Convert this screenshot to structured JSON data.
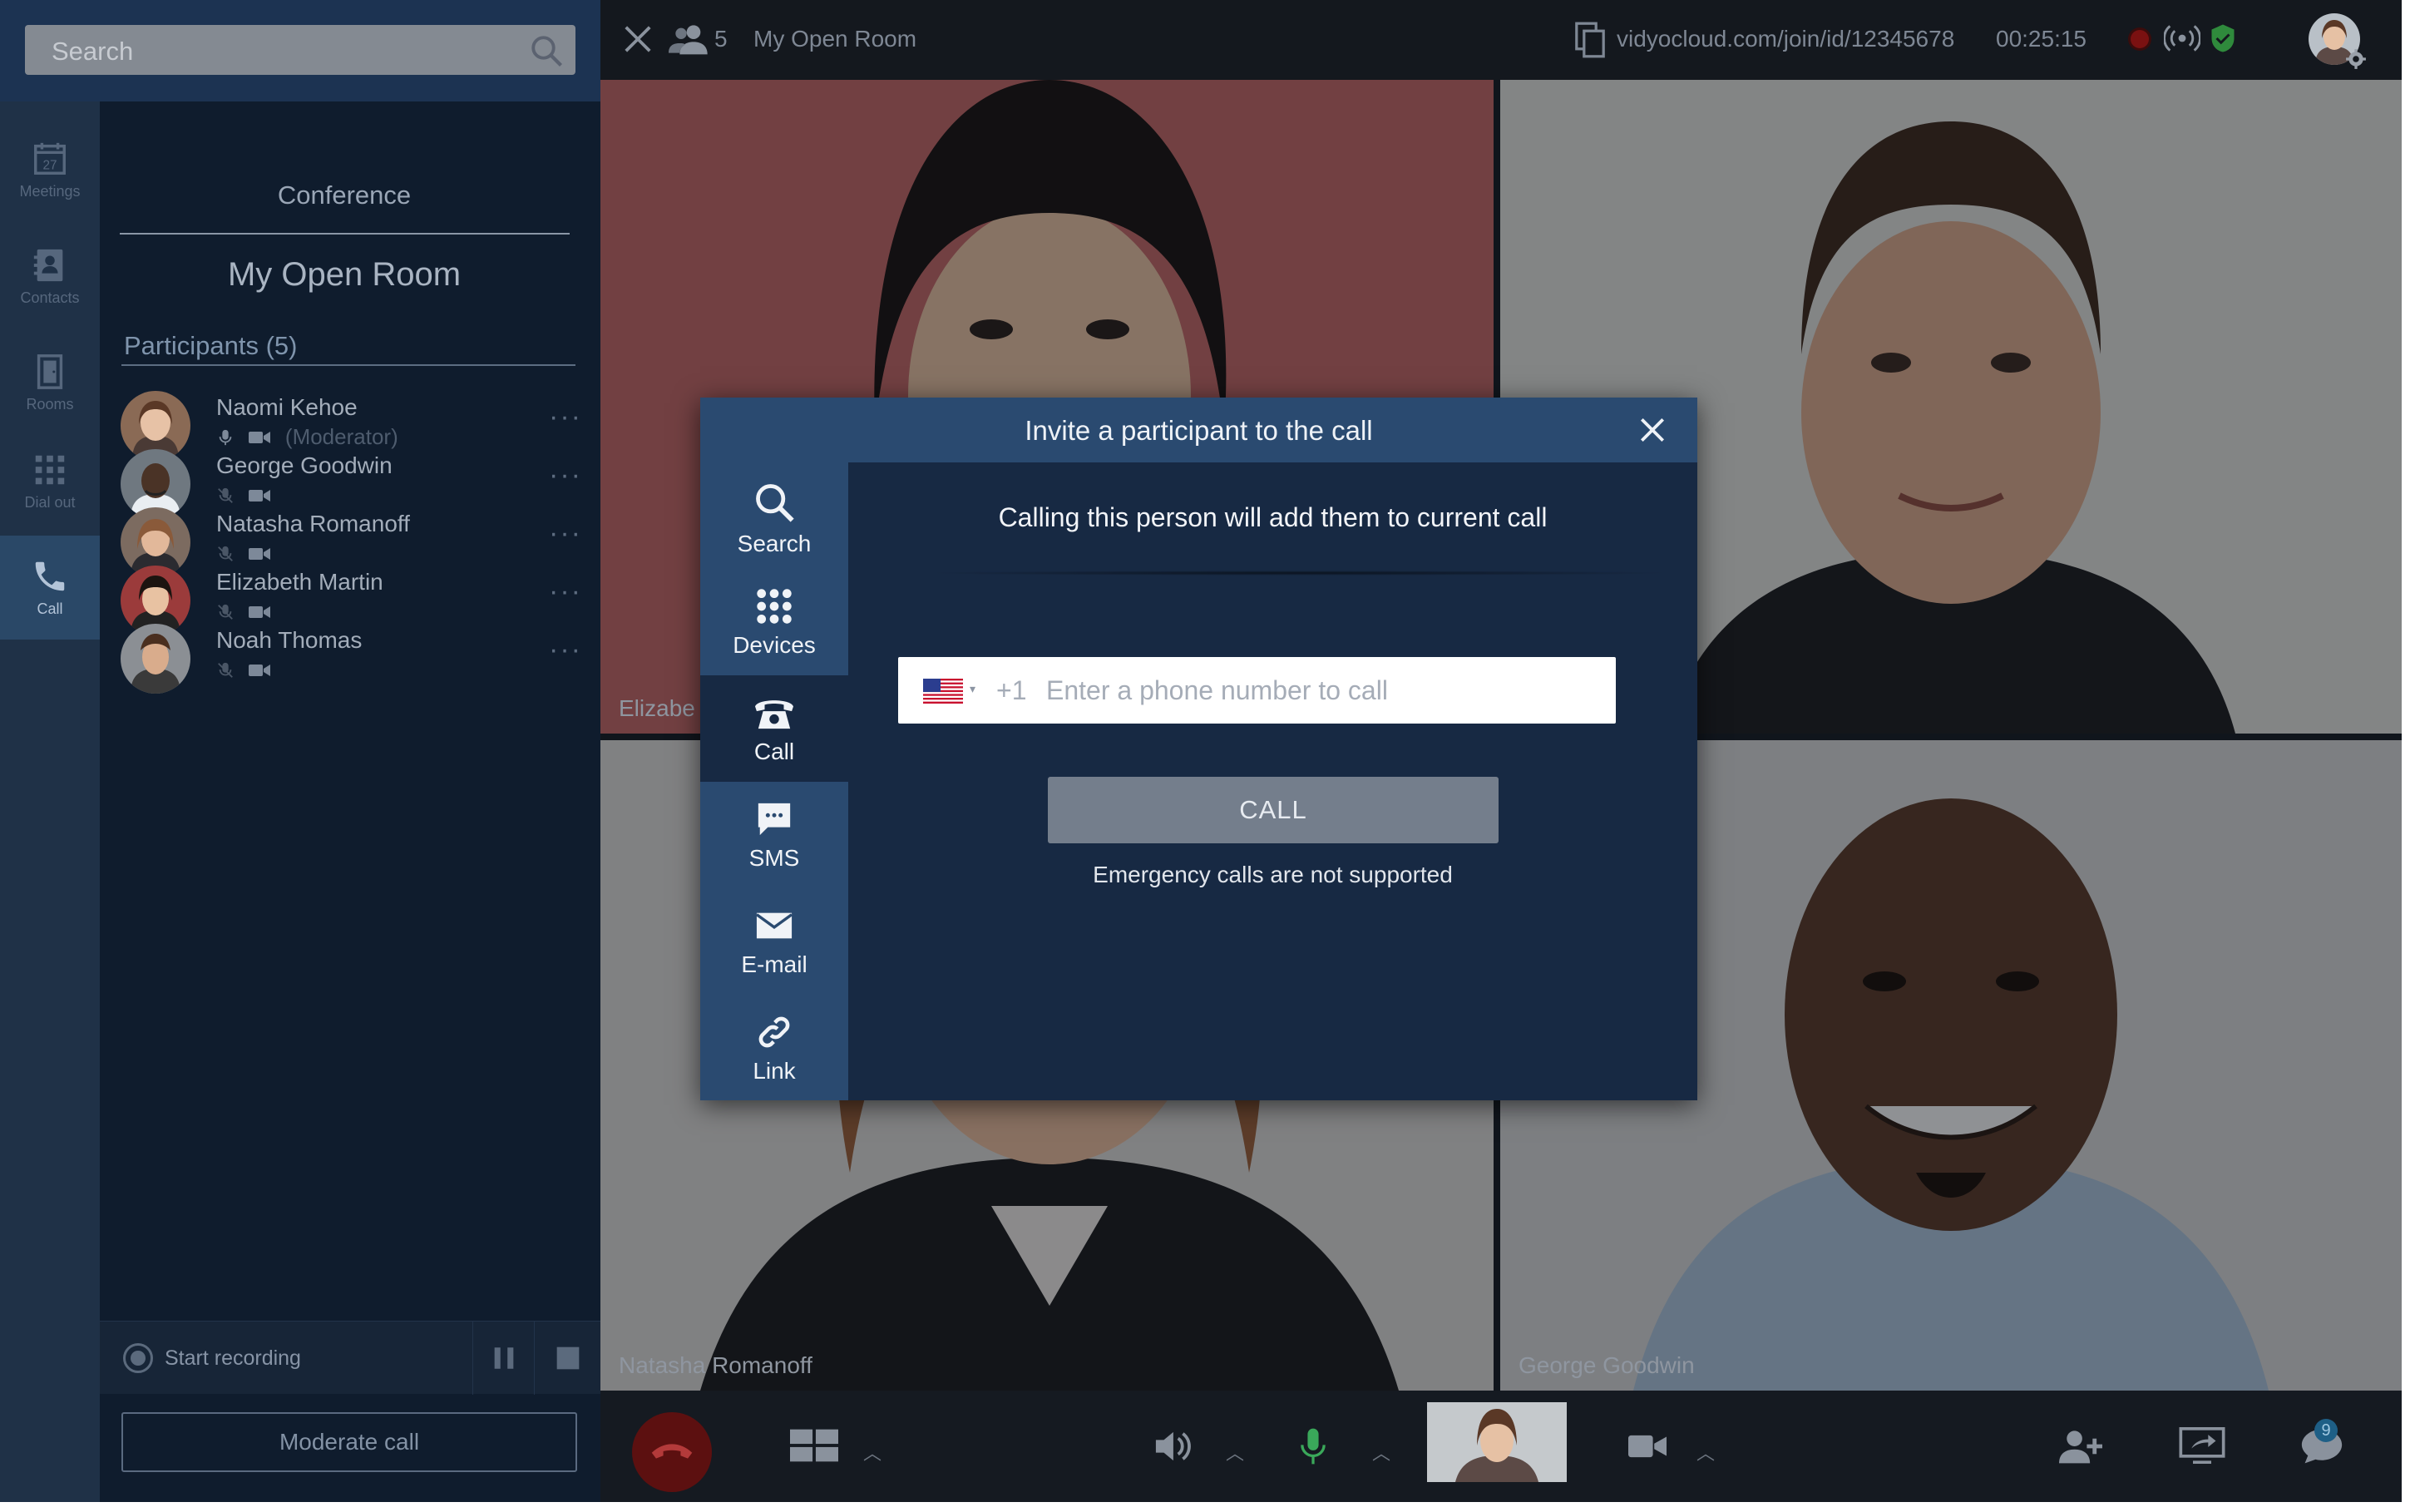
{
  "search": {
    "placeholder": "Search"
  },
  "nav": {
    "items": [
      {
        "label": "Meetings",
        "day": "27"
      },
      {
        "label": "Contacts"
      },
      {
        "label": "Rooms"
      },
      {
        "label": "Dial out"
      },
      {
        "label": "Call"
      }
    ]
  },
  "panel": {
    "section": "Conference",
    "room": "My Open Room",
    "participants_header": "Participants (5)",
    "participants": [
      {
        "name": "Naomi Kehoe",
        "role": "(Moderator)"
      },
      {
        "name": "George Goodwin",
        "role": ""
      },
      {
        "name": "Natasha Romanoff",
        "role": ""
      },
      {
        "name": "Elizabeth Martin",
        "role": ""
      },
      {
        "name": "Noah Thomas",
        "role": ""
      }
    ],
    "recording_label": "Start recording",
    "moderate_label": "Moderate call"
  },
  "topbar": {
    "participant_count": "5",
    "room": "My Open Room",
    "url": "vidyocloud.com/join/id/12345678",
    "timer": "00:25:15"
  },
  "video": {
    "tiles": [
      {
        "label": ""
      },
      {
        "label": ""
      },
      {
        "label": "Natasha Romanoff"
      },
      {
        "label": "George Goodwin"
      }
    ],
    "partial_label": "Elizabe"
  },
  "toolbar": {
    "chat_badge": "9"
  },
  "dialog": {
    "title": "Invite a participant to the call",
    "tabs": [
      "Search",
      "Devices",
      "Call",
      "SMS",
      "E-mail",
      "Link"
    ],
    "active_tab": "Call",
    "hint": "Calling this person will add them to current call",
    "dial_code": "+1",
    "phone_placeholder": "Enter a phone number to call",
    "call_label": "CALL",
    "notice": "Emergency calls are not supported"
  },
  "colors": {
    "accent": "#2a4a70",
    "dialog_bg": "#172943",
    "panel_bg": "#0f1c2d",
    "mic_active": "#3aa85a",
    "secure": "#2f8a3c"
  }
}
